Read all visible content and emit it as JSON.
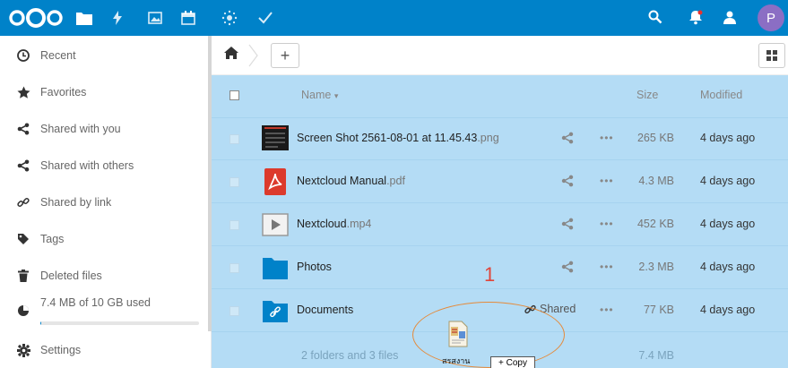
{
  "header": {
    "avatar_letter": "P",
    "brand_color": "#0082c9",
    "apps": [
      "files-icon",
      "activity-icon",
      "gallery-icon",
      "calendar-icon",
      "weather-icon",
      "tasks-icon"
    ],
    "right_icons": [
      "search-icon",
      "notifications-icon",
      "contacts-icon"
    ]
  },
  "sidebar": {
    "items": [
      {
        "label": "Recent",
        "icon": "clock-icon"
      },
      {
        "label": "Favorites",
        "icon": "star-icon"
      },
      {
        "label": "Shared with you",
        "icon": "share-icon"
      },
      {
        "label": "Shared with others",
        "icon": "share-icon"
      },
      {
        "label": "Shared by link",
        "icon": "link-icon"
      },
      {
        "label": "Tags",
        "icon": "tag-icon"
      },
      {
        "label": "Deleted files",
        "icon": "trash-icon"
      }
    ],
    "quota": {
      "label": "7.4 MB of 10 GB used",
      "fraction": 0.00074
    },
    "settings_label": "Settings"
  },
  "file_list": {
    "columns": {
      "name": "Name",
      "size": "Size",
      "modified": "Modified"
    },
    "rows": [
      {
        "base": "Screen Shot 2561-08-01 at 11.45.43",
        "ext": ".png",
        "size": "265 KB",
        "modified": "4 days ago",
        "icon": "image-thumbnail-icon",
        "share": "share-icon",
        "shared_label": ""
      },
      {
        "base": "Nextcloud Manual",
        "ext": ".pdf",
        "size": "4.3 MB",
        "modified": "4 days ago",
        "icon": "pdf-icon",
        "share": "share-icon",
        "shared_label": ""
      },
      {
        "base": "Nextcloud",
        "ext": ".mp4",
        "size": "452 KB",
        "modified": "4 days ago",
        "icon": "video-icon",
        "share": "share-icon",
        "shared_label": ""
      },
      {
        "base": "Photos",
        "ext": "",
        "size": "2.3 MB",
        "modified": "4 days ago",
        "icon": "folder-icon",
        "share": "share-icon",
        "shared_label": ""
      },
      {
        "base": "Documents",
        "ext": "",
        "size": "77 KB",
        "modified": "4 days ago",
        "icon": "folder-link-icon",
        "share": "link-icon",
        "shared_label": "Shared"
      }
    ],
    "summary": {
      "text": "2 folders and 3 files",
      "size": "7.4 MB"
    }
  },
  "drag": {
    "annotation": "1",
    "file_label": "สรสงาน",
    "copy_label": "+ Copy"
  }
}
